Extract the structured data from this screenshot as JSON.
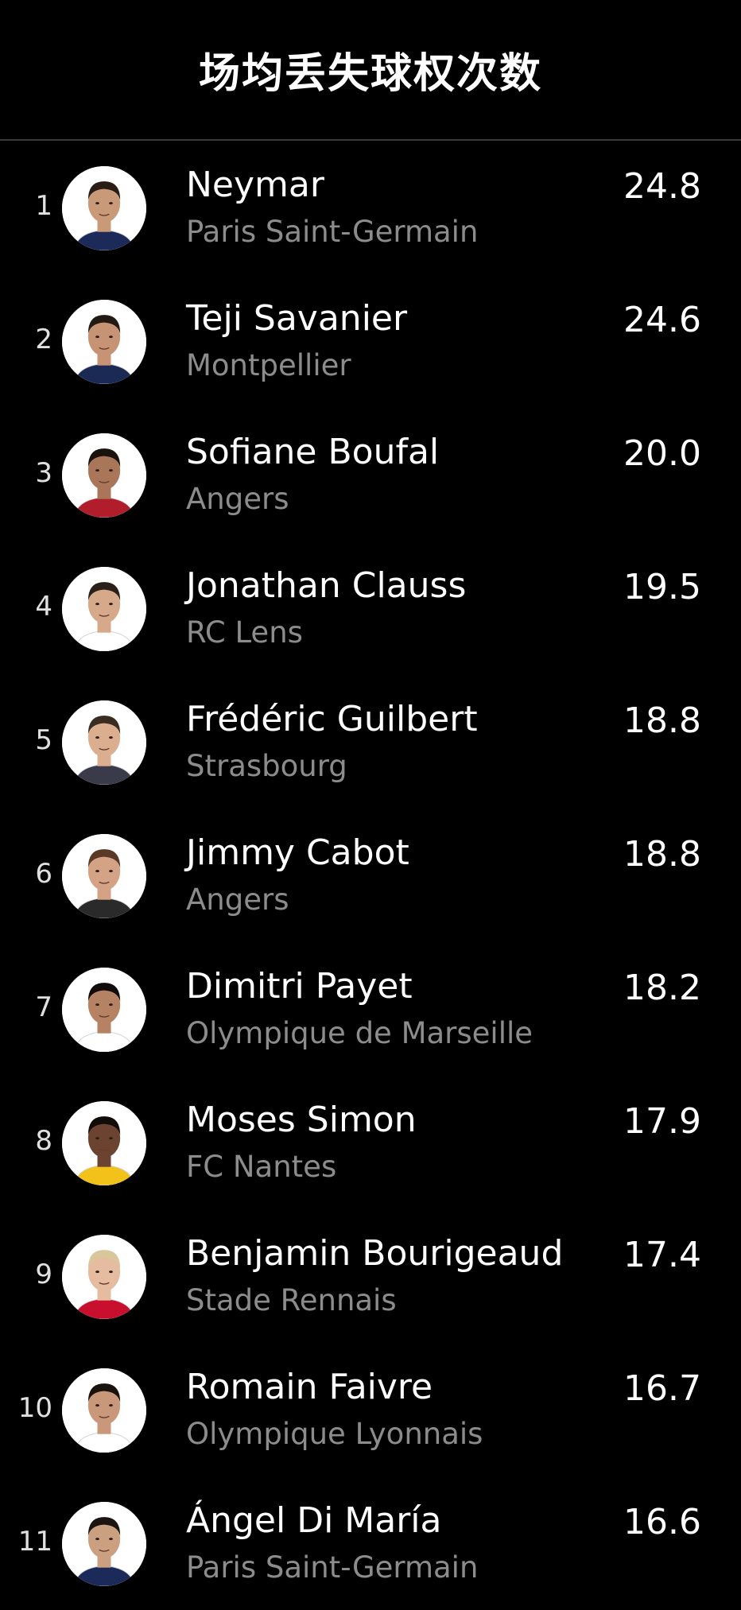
{
  "header": {
    "title": "场均丢失球权次数"
  },
  "players": [
    {
      "rank": "1",
      "name": "Neymar",
      "team": "Paris Saint-Germain",
      "value": "24.8",
      "avatar_icon": "player-photo-icon",
      "skin": "#c99a78",
      "hair": "#2a1d15",
      "kit": "#1c2a5a"
    },
    {
      "rank": "2",
      "name": "Teji Savanier",
      "team": "Montpellier",
      "value": "24.6",
      "avatar_icon": "player-photo-icon",
      "skin": "#c79375",
      "hair": "#231a14",
      "kit": "#1b2a55"
    },
    {
      "rank": "3",
      "name": "Sofiane Boufal",
      "team": "Angers",
      "value": "20.0",
      "avatar_icon": "player-photo-icon",
      "skin": "#a9765a",
      "hair": "#1a120d",
      "kit": "#b11d2a"
    },
    {
      "rank": "4",
      "name": "Jonathan Clauss",
      "team": "RC Lens",
      "value": "19.5",
      "avatar_icon": "player-photo-icon",
      "skin": "#d7a98b",
      "hair": "#2b2019",
      "kit": "#ffffff"
    },
    {
      "rank": "5",
      "name": "Frédéric Guilbert",
      "team": "Strasbourg",
      "value": "18.8",
      "avatar_icon": "player-photo-icon",
      "skin": "#dcae90",
      "hair": "#3b2c22",
      "kit": "#3a3a4a"
    },
    {
      "rank": "6",
      "name": "Jimmy Cabot",
      "team": "Angers",
      "value": "18.8",
      "avatar_icon": "player-photo-icon",
      "skin": "#d4a284",
      "hair": "#5a3a26",
      "kit": "#2a2a2a"
    },
    {
      "rank": "7",
      "name": "Dimitri Payet",
      "team": "Olympique de Marseille",
      "value": "18.2",
      "avatar_icon": "player-photo-icon",
      "skin": "#b58363",
      "hair": "#120d0a",
      "kit": "#ffffff"
    },
    {
      "rank": "8",
      "name": "Moses Simon",
      "team": "FC Nantes",
      "value": "17.9",
      "avatar_icon": "player-photo-icon",
      "skin": "#6b4330",
      "hair": "#120c08",
      "kit": "#f2c21a"
    },
    {
      "rank": "9",
      "name": "Benjamin Bourigeaud",
      "team": "Stade Rennais",
      "value": "17.4",
      "avatar_icon": "player-photo-icon",
      "skin": "#e6bca0",
      "hair": "#d8c79b",
      "kit": "#c8102e"
    },
    {
      "rank": "10",
      "name": "Romain Faivre",
      "team": "Olympique Lyonnais",
      "value": "16.7",
      "avatar_icon": "player-photo-icon",
      "skin": "#c9977a",
      "hair": "#1a120d",
      "kit": "#ffffff"
    },
    {
      "rank": "11",
      "name": "Ángel Di María",
      "team": "Paris Saint-Germain",
      "value": "16.6",
      "avatar_icon": "player-photo-icon",
      "skin": "#caa081",
      "hair": "#1c1410",
      "kit": "#1c2a5a"
    }
  ]
}
